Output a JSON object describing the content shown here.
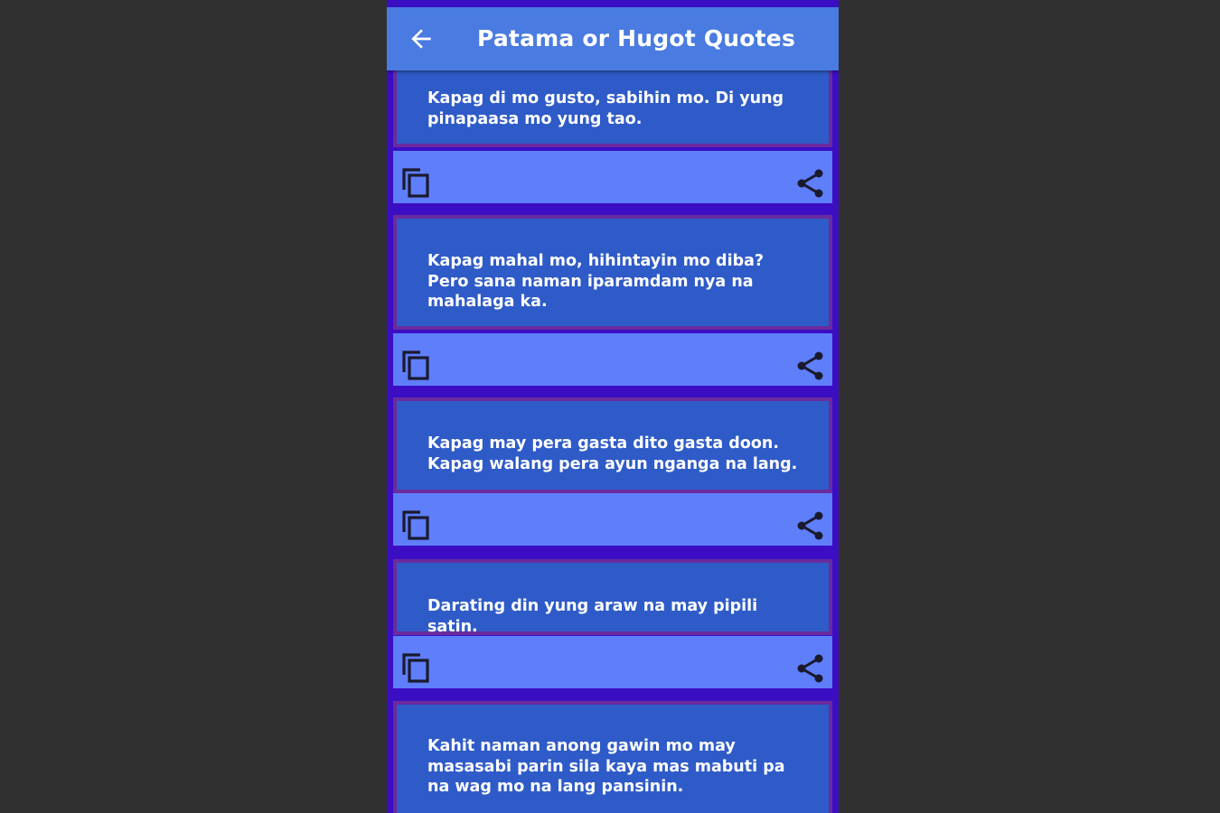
{
  "app_bar": {
    "title": "Patama or Hugot Quotes",
    "back_icon": "arrow-back-icon"
  },
  "quotes": [
    {
      "text": "Kapag di mo gusto, sabihin mo. Di yung pinapaasa mo yung tao."
    },
    {
      "text": "Kapag mahal mo, hihintayin mo diba? Pero sana naman iparamdam nya na mahalaga ka."
    },
    {
      "text": "Kapag may pera gasta dito gasta doon. Kapag walang pera ayun nganga na lang."
    },
    {
      "text": "Darating din yung araw na may pipili satin."
    },
    {
      "text": "Kahit naman anong gawin mo may masasabi parin sila kaya mas mabuti pa na wag mo na lang pansinin."
    }
  ],
  "icons": {
    "copy": "copy-icon",
    "share": "share-icon"
  },
  "colors": {
    "background": "#303030",
    "screen": "#3b0ec4",
    "app_bar": "#4a7be0",
    "quote_card": "#2f5bc8",
    "card_border": "#6a2b9e",
    "action_bar": "#5f7ef9"
  }
}
